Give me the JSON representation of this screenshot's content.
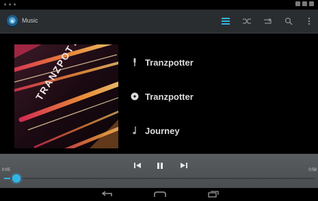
{
  "app": {
    "title": "Music"
  },
  "track": {
    "artist": "Tranzpotter",
    "album": "Tranzpotter",
    "title": "Journey"
  },
  "album_art": {
    "text": "TRANZPOTTER",
    "colors": [
      "#e6305a",
      "#ff9a3c",
      "#ffd07a",
      "#3b1a26"
    ]
  },
  "playback": {
    "elapsed": "0:05",
    "total": "0:58",
    "progress_percent": 2
  },
  "colors": {
    "accent": "#33b5e5",
    "action_bar": "#2a2d30",
    "controls_bar": "#555a5e"
  },
  "icons": {
    "actionbar": [
      "library-icon",
      "shuffle-icon",
      "repeat-icon",
      "search-icon",
      "overflow-menu-icon"
    ],
    "controls": [
      "previous-icon",
      "pause-icon",
      "next-icon"
    ],
    "nav": [
      "back-icon",
      "home-icon",
      "recent-apps-icon"
    ]
  }
}
